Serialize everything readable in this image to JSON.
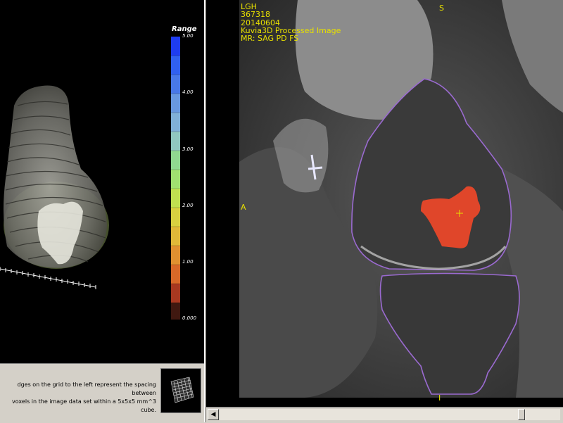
{
  "legend": {
    "title": "Range",
    "ticks": [
      "5.00",
      "4.00",
      "3.00",
      "2.00",
      "1.00",
      "0.000"
    ]
  },
  "info": {
    "line1": "dges on the grid to the left represent the spacing between",
    "line2": "voxels in the image data set within a 5x5x5 mm^3 cube."
  },
  "overlay": {
    "line1": "LGH",
    "line2": "367318",
    "line3": "20140604",
    "line4": "Kuvia3D Processed Image",
    "line5": "MR: SAG PD FS",
    "orient_superior": "S",
    "orient_anterior": "A",
    "orient_inferior": "I"
  },
  "colors": {
    "overlay_text": "#e8e000",
    "lesion": "#e0462a",
    "contour": "#9a6ad0"
  },
  "icons": {
    "scroll_left": "arrow-left-icon"
  }
}
